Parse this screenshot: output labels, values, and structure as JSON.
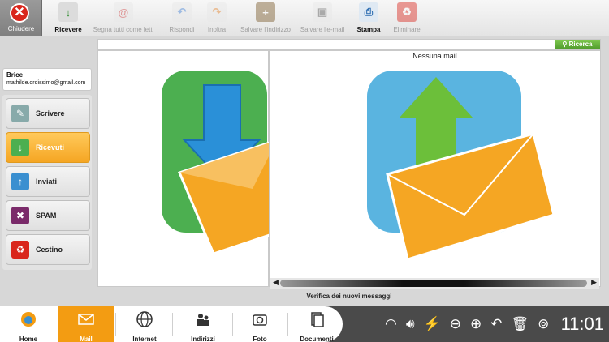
{
  "toolbar": {
    "close_label": "Chiudere",
    "buttons": [
      {
        "label": "Ricevere",
        "enabled": true
      },
      {
        "label": "Segna tutti come letti",
        "enabled": false
      },
      {
        "label": "Rispondi",
        "enabled": false
      },
      {
        "label": "Inoltra",
        "enabled": false
      },
      {
        "label": "Salvare l'indirizzo",
        "enabled": false
      },
      {
        "label": "Salvare l'e-mail",
        "enabled": false
      },
      {
        "label": "Stampa",
        "enabled": true
      },
      {
        "label": "Eliminare",
        "enabled": false
      }
    ]
  },
  "search": {
    "button_label": "Ricerca",
    "value": ""
  },
  "account": {
    "name": "Brice",
    "email": "mathilde.ordissimo@gmail.com"
  },
  "folders": [
    {
      "label": "Scrivere",
      "icon": "compose-icon"
    },
    {
      "label": "Ricevuti",
      "icon": "inbox-icon",
      "selected": true
    },
    {
      "label": "Inviati",
      "icon": "sent-icon"
    },
    {
      "label": "SPAM",
      "icon": "spam-trash-icon"
    },
    {
      "label": "Cestino",
      "icon": "trash-icon"
    }
  ],
  "main": {
    "no_mail_text": "Nessuna mail",
    "status_text": "Verifica dei nuovi messaggi"
  },
  "dock": {
    "items": [
      {
        "label": "Home"
      },
      {
        "label": "Mail",
        "active": true
      },
      {
        "label": "Internet"
      },
      {
        "label": "Indirizzi"
      },
      {
        "label": "Foto"
      },
      {
        "label": "Documenti"
      }
    ],
    "clock": "11:01"
  },
  "colors": {
    "accent": "#f39c12",
    "close": "#d9261c",
    "search": "#5aa832"
  }
}
